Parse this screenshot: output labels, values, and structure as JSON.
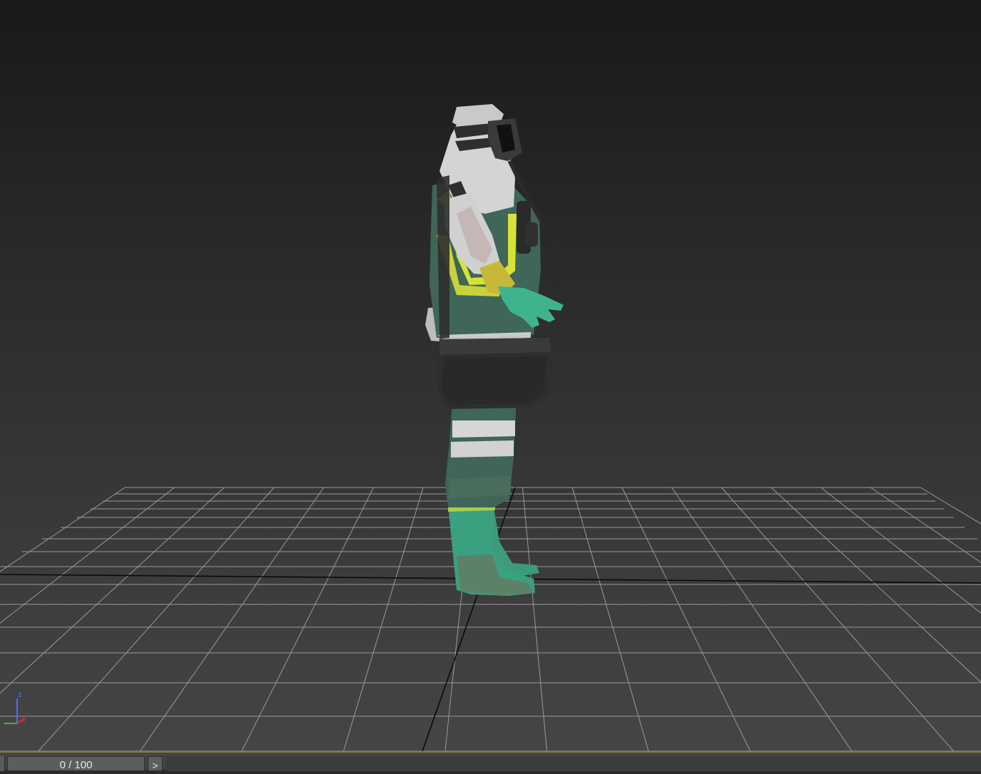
{
  "viewport": {
    "name": "perspective-viewport",
    "axis_gizmo": {
      "z_label": "z",
      "x_label": "x",
      "z_color": "#4a6cff",
      "x_color": "#e03030",
      "y_color": "#30c030"
    }
  },
  "timeline": {
    "frame_indicator": "0 / 100",
    "next_button": ">"
  },
  "colors": {
    "grid_line": "#9a9a9a",
    "grid_axis": "#0a0a0a",
    "suit_white": "#d8d8d8",
    "suit_green": "#3e6a58",
    "vest_yellow": "#d6e23a",
    "glove_green": "#3fb38e",
    "bag_dark": "#2d2d2d"
  }
}
